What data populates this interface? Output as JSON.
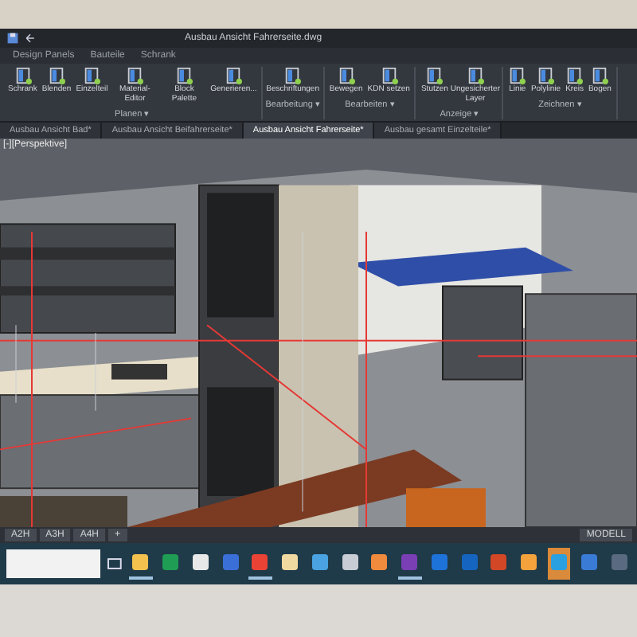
{
  "window": {
    "title": "Ausbau Ansicht Fahrerseite.dwg"
  },
  "ribbon_tabs": [
    {
      "label": "Design Panels",
      "selected": false
    },
    {
      "label": "Bauteile",
      "selected": false
    },
    {
      "label": "Schrank",
      "selected": false
    }
  ],
  "ribbon_groups": [
    {
      "title": "Planen ▾",
      "tools": [
        "Schrank",
        "Blenden",
        "Einzelteil",
        "Material-Editor",
        "Block Palette",
        "Generieren..."
      ]
    },
    {
      "title": "Bearbeitung ▾",
      "tools": [
        "Beschriftungen"
      ]
    },
    {
      "title": "Bearbeiten ▾",
      "tools": [
        "Bewegen",
        "KDN setzen"
      ]
    },
    {
      "title": "Anzeige ▾",
      "tools": [
        "Stutzen",
        "Ungesicherter Layer"
      ]
    },
    {
      "title": "Zeichnen ▾",
      "tools": [
        "Linie",
        "Polylinie",
        "Kreis",
        "Bogen"
      ]
    }
  ],
  "doc_tabs": [
    {
      "label": "Ausbau Ansicht Bad*",
      "selected": false
    },
    {
      "label": "Ausbau Ansicht Beifahrerseite*",
      "selected": false
    },
    {
      "label": "Ausbau Ansicht Fahrerseite*",
      "selected": true
    },
    {
      "label": "Ausbau gesamt Einzelteile*",
      "selected": false
    }
  ],
  "viewport": {
    "label": "[-][Perspektive]"
  },
  "layout_tabs": [
    {
      "label": "A2H"
    },
    {
      "label": "A3H"
    },
    {
      "label": "A4H"
    },
    {
      "label": "+"
    }
  ],
  "status_bar": {
    "mode": "MODELL"
  },
  "taskbar": {
    "apps": [
      {
        "color": "#f2c14e",
        "running": true,
        "selected": false
      },
      {
        "color": "#1f9d55",
        "running": false,
        "selected": false
      },
      {
        "color": "#e8e8e8",
        "running": false,
        "selected": false
      },
      {
        "color": "#3b6fd8",
        "running": false,
        "selected": false
      },
      {
        "color": "#ea4335",
        "running": true,
        "selected": false
      },
      {
        "color": "#f0d9a0",
        "running": false,
        "selected": false
      },
      {
        "color": "#4aa3e0",
        "running": false,
        "selected": false
      },
      {
        "color": "#c8ccd4",
        "running": false,
        "selected": false
      },
      {
        "color": "#f08a3c",
        "running": false,
        "selected": false
      },
      {
        "color": "#7b3fb5",
        "running": true,
        "selected": false
      },
      {
        "color": "#1e73d8",
        "running": false,
        "selected": false
      },
      {
        "color": "#1565c0",
        "running": false,
        "selected": false
      },
      {
        "color": "#d24726",
        "running": false,
        "selected": false
      },
      {
        "color": "#f3a23c",
        "running": false,
        "selected": false
      },
      {
        "color": "#2aa0e0",
        "running": false,
        "selected": true
      },
      {
        "color": "#3a7bd5",
        "running": false,
        "selected": false
      },
      {
        "color": "#5a6a80",
        "running": false,
        "selected": false
      }
    ]
  }
}
